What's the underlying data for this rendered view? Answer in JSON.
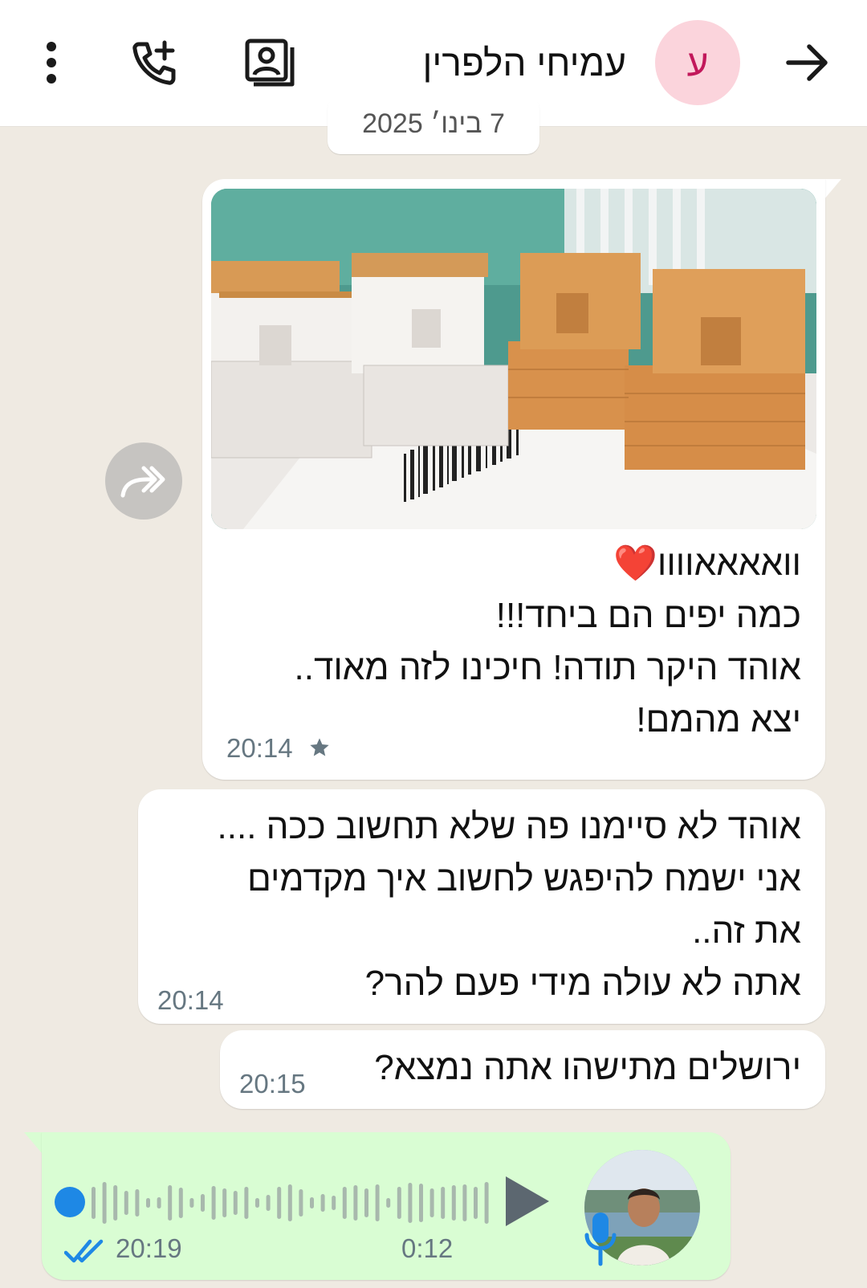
{
  "header": {
    "title": "עמיחי הלפרין",
    "avatar_letter": "ע",
    "icons": [
      "more-vert-icon",
      "add-call-icon",
      "contact-card-icon",
      "back-arrow-icon"
    ]
  },
  "date_pill": {
    "text": "7 בינו׳ 2025"
  },
  "messages": [
    {
      "lines": [
        "וואאאאוווו❤️",
        "כמה יפים הם ביחד!!!",
        "אוהד היקר תודה! חיכינו לזה מאוד..",
        "יצא מהמם!"
      ],
      "time": "20:14",
      "starred": true,
      "has_image": true
    },
    {
      "lines": [
        "אוהד לא סיימנו פה שלא תחשוב ככה ....",
        "אני ישמח להיפגש לחשוב איך מקדמים",
        "את זה..",
        "אתה לא עולה מידי פעם להר?"
      ],
      "time": "20:14"
    },
    {
      "lines": [
        "ירושלים מתישהו אתה נמצא?"
      ],
      "time": "20:15"
    }
  ],
  "voice_message": {
    "time": "20:19",
    "duration": "0:12",
    "progress": 0.0,
    "status": "read"
  },
  "colors": {
    "chat_bg": "#efeae2",
    "outgoing_bubble": "#d9fdd3",
    "incoming_bubble": "#ffffff",
    "read_tick": "#1e88e5",
    "avatar_bg": "#fbd4dc"
  }
}
